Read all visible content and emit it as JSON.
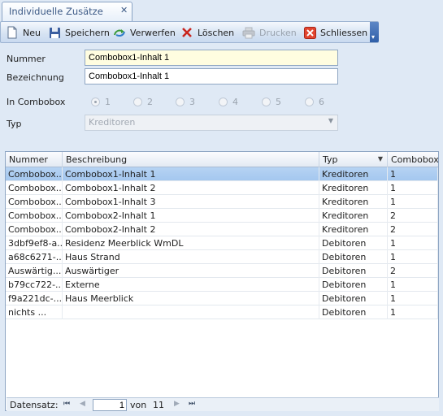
{
  "tab": {
    "title": "Individuelle Zusätze",
    "close": "✕"
  },
  "toolbar": {
    "new_label": "Neu",
    "save_label": "Speichern",
    "discard_label": "Verwerfen",
    "delete_label": "Löschen",
    "print_label": "Drucken",
    "close_label": "Schliessen",
    "overflow": "▾"
  },
  "form": {
    "nummer_label": "Nummer",
    "nummer_value": "Combobox1-Inhalt 1",
    "bezeichnung_label": "Bezeichnung",
    "bezeichnung_value": "Combobox1-Inhalt 1",
    "combobox_label": "In Combobox",
    "combobox_options": [
      "1",
      "2",
      "3",
      "4",
      "5",
      "6"
    ],
    "combobox_selected": "1",
    "typ_label": "Typ",
    "typ_value": "Kreditoren",
    "typ_arrow": "▼"
  },
  "grid": {
    "columns": [
      "Nummer",
      "Beschreibung",
      "Typ",
      "Combobox"
    ],
    "sort_indicator": "▼",
    "rows": [
      [
        "Combobox...",
        "Combobox1-Inhalt 1",
        "Kreditoren",
        "1"
      ],
      [
        "Combobox...",
        "Combobox1-Inhalt 2",
        "Kreditoren",
        "1"
      ],
      [
        "Combobox...",
        "Combobox1-Inhalt 3",
        "Kreditoren",
        "1"
      ],
      [
        "Combobox...",
        "Combobox2-Inhalt 1",
        "Kreditoren",
        "2"
      ],
      [
        "Combobox...",
        "Combobox2-Inhalt 2",
        "Kreditoren",
        "2"
      ],
      [
        "3dbf9ef8-a...",
        "Residenz Meerblick WmDL",
        "Debitoren",
        "1"
      ],
      [
        "a68c6271-...",
        "Haus Strand",
        "Debitoren",
        "1"
      ],
      [
        "Auswärtig...",
        "Auswärtiger",
        "Debitoren",
        "2"
      ],
      [
        "b79cc722-...",
        "Externe",
        "Debitoren",
        "1"
      ],
      [
        "f9a221dc-...",
        "Haus Meerblick",
        "Debitoren",
        "1"
      ],
      [
        "nichts     ...",
        "",
        "Debitoren",
        "1"
      ]
    ],
    "selected_row": 0
  },
  "navigator": {
    "label": "Datensatz:",
    "first": "⏮",
    "prev": "◀",
    "current": "1",
    "of": "von",
    "total": "11",
    "next": "▶",
    "last": "⏭"
  },
  "colors": {
    "selection": "#a4c7ef",
    "toolbar_accent": "#2f5fa8"
  }
}
